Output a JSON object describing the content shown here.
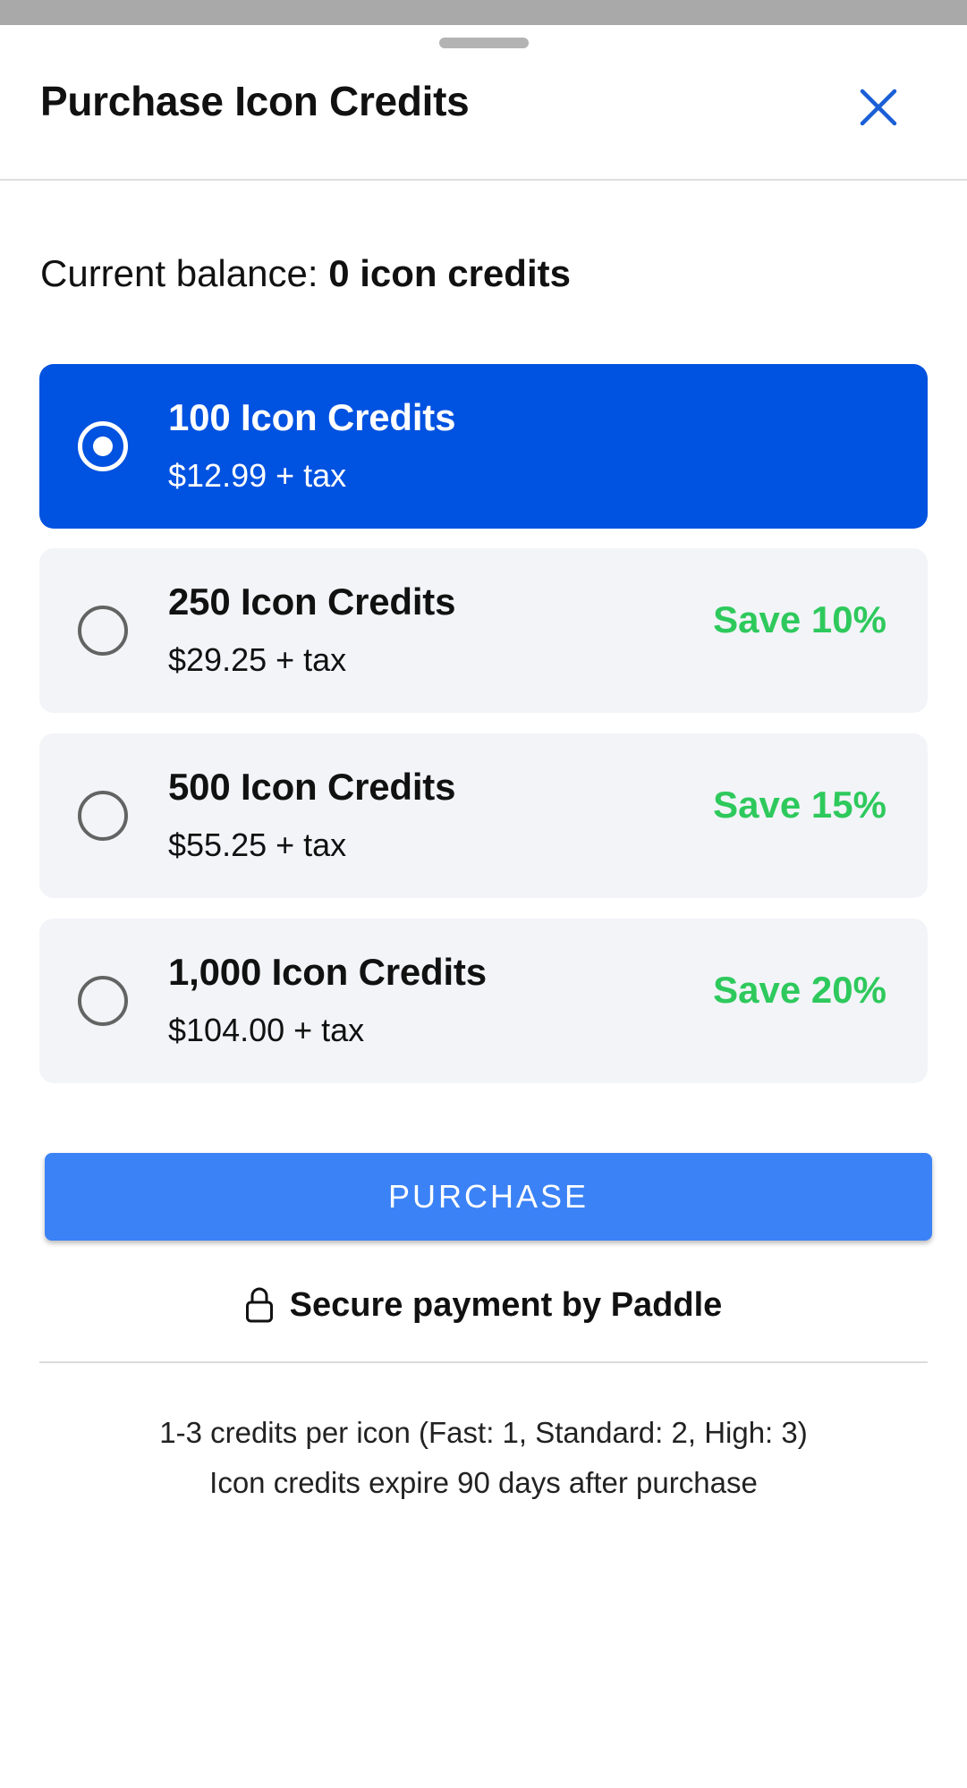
{
  "sheet": {
    "title": "Purchase Icon Credits"
  },
  "balance": {
    "label": "Current balance: ",
    "value": "0 icon credits"
  },
  "options": [
    {
      "name": "100 Icon Credits",
      "price": "$12.99 + tax",
      "save": "",
      "selected": true
    },
    {
      "name": "250 Icon Credits",
      "price": "$29.25 + tax",
      "save": "Save 10%",
      "selected": false
    },
    {
      "name": "500 Icon Credits",
      "price": "$55.25 + tax",
      "save": "Save 15%",
      "selected": false
    },
    {
      "name": "1,000 Icon Credits",
      "price": "$104.00 + tax",
      "save": "Save 20%",
      "selected": false
    }
  ],
  "purchase": {
    "label": "PURCHASE"
  },
  "secure": {
    "icon": "lock-icon",
    "label": "Secure payment by Paddle"
  },
  "footer": {
    "line1": "1-3 credits per icon (Fast: 1, Standard: 2, High: 3)",
    "line2": "Icon credits expire 90 days after purchase"
  },
  "colors": {
    "selected_bg": "#0052e0",
    "button_bg": "#3b82f6",
    "save_text": "#2ec95c",
    "close_icon": "#1a5fd6",
    "unselected_bg": "#f2f4f8"
  }
}
